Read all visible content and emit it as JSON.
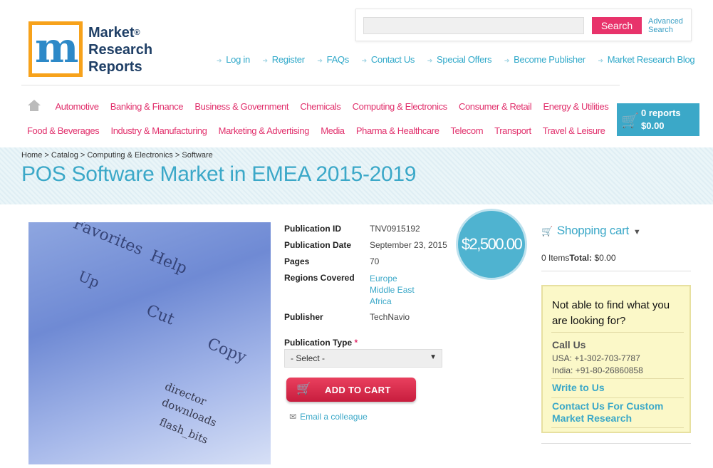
{
  "logo": {
    "line1": "Market",
    "line2": "Research",
    "line3": "Reports",
    "reg": "®"
  },
  "search": {
    "placeholder": "",
    "button": "Search",
    "advanced_line1": "Advanced",
    "advanced_line2": "Search"
  },
  "top_links": [
    "Log in",
    "Register",
    "FAQs",
    "Contact Us",
    "Special Offers",
    "Become Publisher",
    "Market Research Blog"
  ],
  "categories_row1": [
    "Automotive",
    "Banking & Finance",
    "Business & Government",
    "Chemicals",
    "Computing & Electronics",
    "Consumer & Retail",
    "Energy & Utilities"
  ],
  "categories_row2": [
    "Food & Beverages",
    "Industry & Manufacturing",
    "Marketing & Advertising",
    "Media",
    "Pharma & Healthcare",
    "Telecom",
    "Transport",
    "Travel & Leisure"
  ],
  "cart_widget": {
    "reports": "0 reports",
    "total": "$0.00"
  },
  "breadcrumb": [
    "Home",
    "Catalog",
    "Computing & Electronics",
    "Software"
  ],
  "page_title": "POS Software Market in EMEA 2015-2019",
  "product_image_text": {
    "favorites": "Favorites",
    "help": "Help",
    "up": "Up",
    "cut": "Cut",
    "copy": "Copy",
    "director": "director",
    "downloads": "downloads",
    "flash": "flash_bits"
  },
  "meta": {
    "publication_id_label": "Publication ID",
    "publication_id": "TNV0915192",
    "publication_date_label": "Publication Date",
    "publication_date": "September 23, 2015",
    "pages_label": "Pages",
    "pages": "70",
    "regions_label": "Regions Covered",
    "regions": [
      "Europe",
      "Middle East",
      "Africa"
    ],
    "publisher_label": "Publisher",
    "publisher": "TechNavio"
  },
  "price": "$2,500.00",
  "publication_type": {
    "label": "Publication Type",
    "required": "*",
    "selected": "- Select -"
  },
  "add_to_cart": "ADD TO CART",
  "email_colleague": "Email a colleague",
  "shopping_cart": {
    "title": "Shopping cart",
    "items": "0 Items",
    "total_label": "Total:",
    "total": "$0.00"
  },
  "help_box": {
    "question": "Not able to find what you are looking for?",
    "call_us": "Call Us",
    "usa_phone": "USA: +1-302-703-7787",
    "india_phone": "India: +91-80-26860858",
    "write_to_us": "Write to Us",
    "custom_research": "Contact Us For Custom Market Research"
  }
}
